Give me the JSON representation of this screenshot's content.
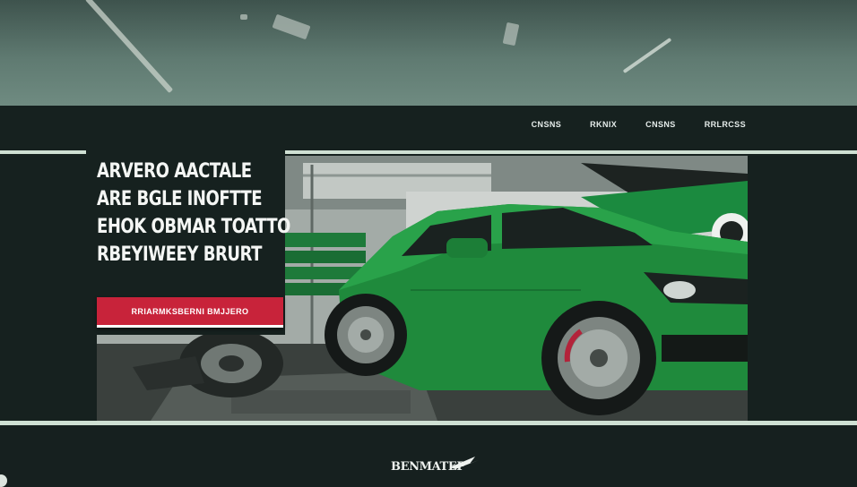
{
  "header": {
    "nav": [
      {
        "label": "CNSNS"
      },
      {
        "label": "RKNIX"
      },
      {
        "label": "CNSNS"
      },
      {
        "label": "RRLRCSS"
      }
    ]
  },
  "hero": {
    "headline": [
      "ARVERO AACTALE",
      "ARE BGLE INOFTTE",
      "EHOK OBMAR TOATTO",
      "RBEYIWEEY BRURT"
    ],
    "cta_label": "RRIARMKSBERNI   BMJJERO"
  },
  "footer": {
    "logo_text": "BENMATEP"
  },
  "colors": {
    "background": "#16211f",
    "accent_red": "#c8233a",
    "rule": "#cfe0d3",
    "car_green": "#1f8a3c"
  }
}
